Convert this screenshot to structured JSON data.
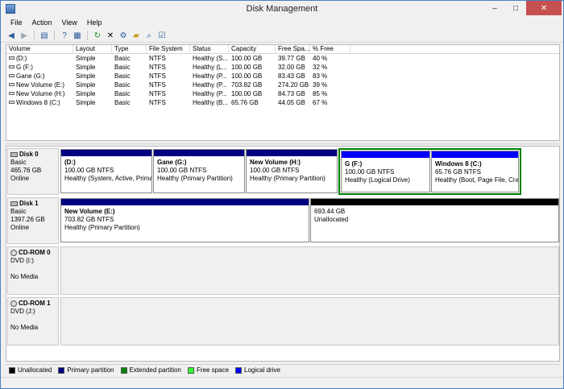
{
  "window": {
    "title": "Disk Management",
    "controls": {
      "minimize": "–",
      "maximize": "□",
      "close": "✕"
    }
  },
  "menu": [
    "File",
    "Action",
    "View",
    "Help"
  ],
  "toolbar": [
    "back-arrow-icon",
    "forward-arrow-icon",
    "disk-view-icon",
    "help-icon",
    "properties-icon",
    "refresh-icon",
    "delete-icon",
    "settings-icon",
    "open-folder-icon",
    "search-icon",
    "checklist-icon"
  ],
  "volume_list": {
    "columns": [
      "Volume",
      "Layout",
      "Type",
      "File System",
      "Status",
      "Capacity",
      "Free Spa...",
      "% Free"
    ],
    "rows": [
      [
        "(D:)",
        "Simple",
        "Basic",
        "NTFS",
        "Healthy (S...",
        "100.00 GB",
        "39.77 GB",
        "40 %"
      ],
      [
        "G (F:)",
        "Simple",
        "Basic",
        "NTFS",
        "Healthy (L...",
        "100.00 GB",
        "32.00 GB",
        "32 %"
      ],
      [
        "Gane (G:)",
        "Simple",
        "Basic",
        "NTFS",
        "Healthy (P...",
        "100.00 GB",
        "83.43 GB",
        "83 %"
      ],
      [
        "New Volume (E:)",
        "Simple",
        "Basic",
        "NTFS",
        "Healthy (P...",
        "703.82 GB",
        "274.20 GB",
        "39 %"
      ],
      [
        "New Volume (H:)",
        "Simple",
        "Basic",
        "NTFS",
        "Healthy (P...",
        "100.00 GB",
        "84.73 GB",
        "85 %"
      ],
      [
        "Windows 8 (C:)",
        "Simple",
        "Basic",
        "NTFS",
        "Healthy (B...",
        "65.76 GB",
        "44.05 GB",
        "67 %"
      ]
    ]
  },
  "disks": {
    "disk0": {
      "name": "Disk 0",
      "type": "Basic",
      "size": "465.76 GB",
      "status": "Online",
      "partitions": [
        {
          "name": "(D:)",
          "size": "100.00 GB NTFS",
          "status": "Healthy (System, Active, Primar"
        },
        {
          "name": "Gane  (G:)",
          "size": "100.00 GB NTFS",
          "status": "Healthy (Primary Partition)"
        },
        {
          "name": "New Volume  (H:)",
          "size": "100.00 GB NTFS",
          "status": "Healthy (Primary Partition)"
        },
        {
          "name": "G  (F:)",
          "size": "100.00 GB NTFS",
          "status": "Healthy (Logical Drive)"
        },
        {
          "name": "Windows 8  (C:)",
          "size": "65.76 GB NTFS",
          "status": "Healthy (Boot, Page File, Crash"
        }
      ]
    },
    "disk1": {
      "name": "Disk 1",
      "type": "Basic",
      "size": "1397.26 GB",
      "status": "Online",
      "partitions": [
        {
          "name": "New Volume  (E:)",
          "size": "703.82 GB NTFS",
          "status": "Healthy (Primary Partition)"
        },
        {
          "name": "",
          "size": "693.44 GB",
          "status": "Unallocated"
        }
      ]
    },
    "cdrom0": {
      "name": "CD-ROM 0",
      "type": "DVD (I:)",
      "status": "No Media"
    },
    "cdrom1": {
      "name": "CD-ROM 1",
      "type": "DVD (J:)",
      "status": "No Media"
    }
  },
  "legend": [
    {
      "label": "Unallocated",
      "color": "#000000"
    },
    {
      "label": "Primary partition",
      "color": "#000080"
    },
    {
      "label": "Extended partition",
      "color": "#008000"
    },
    {
      "label": "Free space",
      "color": "#33ff33"
    },
    {
      "label": "Logical drive",
      "color": "#0000ff"
    }
  ]
}
